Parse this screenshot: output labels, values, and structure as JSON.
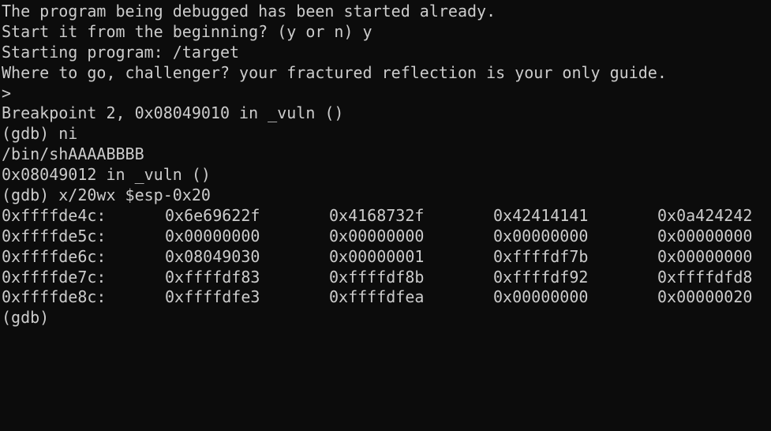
{
  "terminal": {
    "colors": {
      "background": "#0c0c0c",
      "foreground": "#cccccc"
    },
    "lines_top": [
      "The program being debugged has been started already.",
      "Start it from the beginning? (y or n) y",
      "Starting program: /target",
      "Where to go, challenger? your fractured reflection is your only guide.",
      ">",
      "Breakpoint 2, 0x08049010 in _vuln ()",
      "(gdb) ni",
      "/bin/shAAAABBBB",
      "0x08049012 in _vuln ()",
      "(gdb) x/20wx $esp-0x20"
    ],
    "memory_dump": [
      {
        "addr": "0xffffde4c:",
        "words": [
          "0x6e69622f",
          "0x4168732f",
          "0x42414141",
          "0x0a424242"
        ]
      },
      {
        "addr": "0xffffde5c:",
        "words": [
          "0x00000000",
          "0x00000000",
          "0x00000000",
          "0x00000000"
        ]
      },
      {
        "addr": "0xffffde6c:",
        "words": [
          "0x08049030",
          "0x00000001",
          "0xffffdf7b",
          "0x00000000"
        ]
      },
      {
        "addr": "0xffffde7c:",
        "words": [
          "0xffffdf83",
          "0xffffdf8b",
          "0xffffdf92",
          "0xffffdfd8"
        ]
      },
      {
        "addr": "0xffffde8c:",
        "words": [
          "0xffffdfe3",
          "0xffffdfea",
          "0x00000000",
          "0x00000020"
        ]
      }
    ],
    "prompt": "(gdb)"
  }
}
